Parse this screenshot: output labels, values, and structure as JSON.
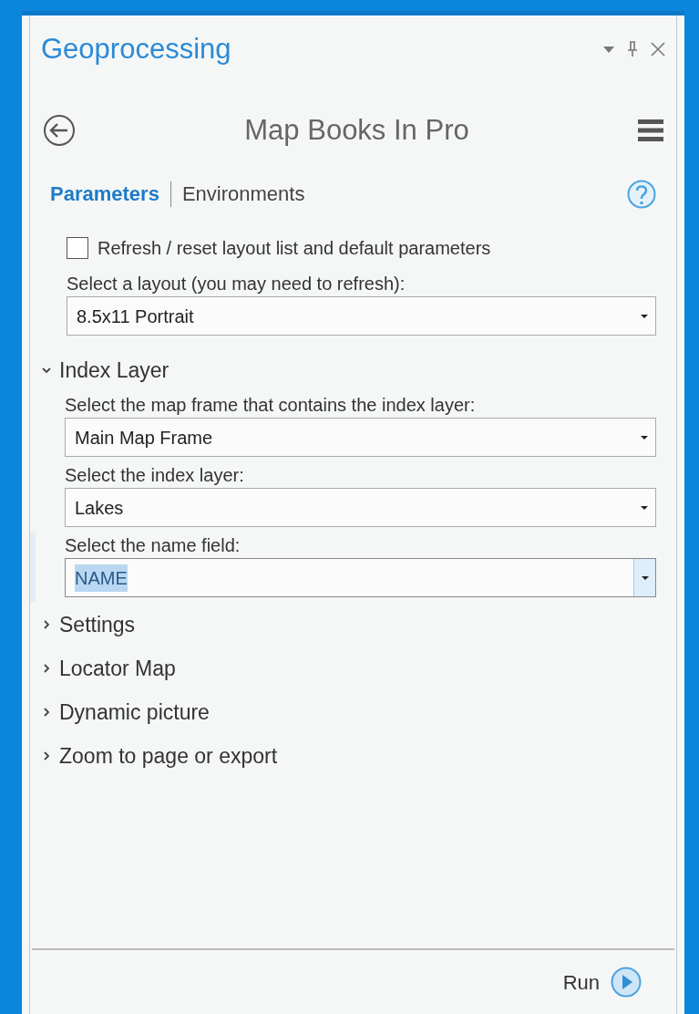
{
  "window": {
    "title": "Geoprocessing"
  },
  "tool": {
    "title": "Map Books In Pro"
  },
  "tabs": [
    {
      "label": "Parameters",
      "selected": true
    },
    {
      "label": "Environments",
      "selected": false
    }
  ],
  "refresh": {
    "label": "Refresh / reset layout list and default parameters",
    "checked": false
  },
  "layout": {
    "label": "Select a layout (you may need to refresh):",
    "value": "8.5x11 Portrait",
    "focused": false
  },
  "sections": [
    {
      "title": "Index Layer",
      "expanded": true,
      "fields": [
        {
          "label": "Select the map frame that contains the index layer:",
          "value": "Main Map Frame",
          "focused": false
        },
        {
          "label": "Select the index layer:",
          "value": "Lakes",
          "focused": false
        },
        {
          "label": "Select the name field:",
          "value": "NAME",
          "focused": true
        }
      ]
    },
    {
      "title": "Settings",
      "expanded": false
    },
    {
      "title": "Locator Map",
      "expanded": false
    },
    {
      "title": "Dynamic picture",
      "expanded": false
    },
    {
      "title": "Zoom to page or export",
      "expanded": false
    }
  ],
  "run_button": {
    "label": "Run"
  }
}
